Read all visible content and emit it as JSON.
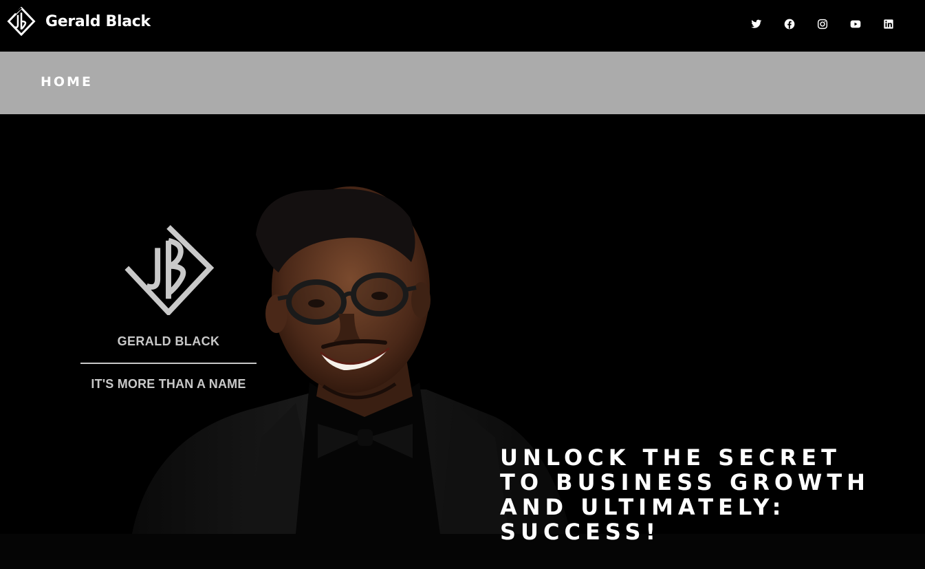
{
  "header": {
    "brand_name": "Gerald Black",
    "logo_icon": "jb-diamond-logo-icon"
  },
  "social": [
    {
      "name": "twitter",
      "icon": "twitter-icon"
    },
    {
      "name": "facebook",
      "icon": "facebook-icon"
    },
    {
      "name": "instagram",
      "icon": "instagram-icon"
    },
    {
      "name": "youtube",
      "icon": "youtube-icon"
    },
    {
      "name": "linkedin",
      "icon": "linkedin-icon"
    }
  ],
  "nav": {
    "home_label": "HOME"
  },
  "hero": {
    "card_name": "GERALD BLACK",
    "card_tagline": "IT'S MORE THAN A NAME",
    "headline_lines": [
      "UNLOCK THE SECRET",
      "TO BUSINESS GROWTH",
      "AND ULTIMATELY:",
      "SUCCESS!"
    ]
  },
  "colors": {
    "background": "#000000",
    "nav_bar": "#ababab",
    "text": "#ffffff",
    "card_text": "#c9c9c9"
  }
}
